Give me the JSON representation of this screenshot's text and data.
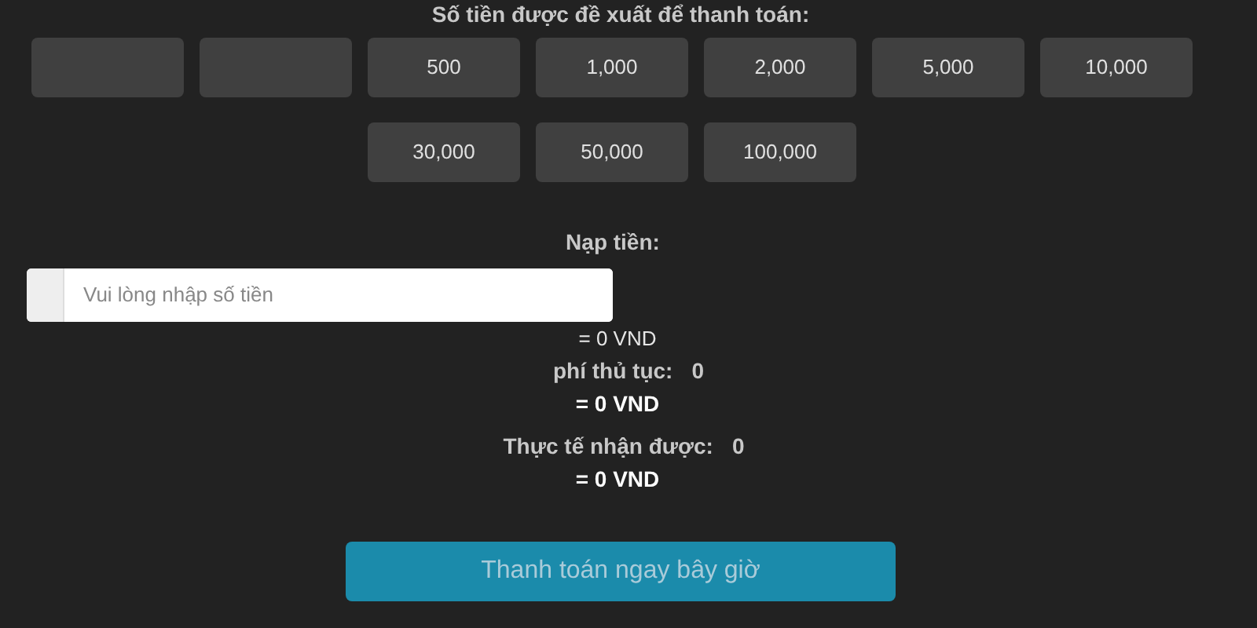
{
  "suggested_title": "Số tiền được đề xuất để thanh toán:",
  "amounts": [
    {
      "kind": "blank"
    },
    {
      "kind": "blank"
    },
    {
      "kind": "amount",
      "label": "500"
    },
    {
      "kind": "amount",
      "label": "1,000"
    },
    {
      "kind": "amount",
      "label": "2,000"
    },
    {
      "kind": "amount",
      "label": "5,000"
    },
    {
      "kind": "amount",
      "label": "10,000"
    },
    {
      "kind": "amount",
      "label": "30,000"
    },
    {
      "kind": "amount",
      "label": "50,000"
    },
    {
      "kind": "amount",
      "label": "100,000"
    }
  ],
  "deposit": {
    "label": "Nạp tiền:",
    "placeholder": "Vui lòng nhập số tiền",
    "converted": "= 0 VND"
  },
  "fee": {
    "label": "phí thủ tục:",
    "value": "0",
    "converted": "= 0 VND"
  },
  "received": {
    "label": "Thực tế nhận được:",
    "value": "0",
    "converted": "= 0 VND"
  },
  "pay_button": "Thanh toán ngay bây giờ"
}
